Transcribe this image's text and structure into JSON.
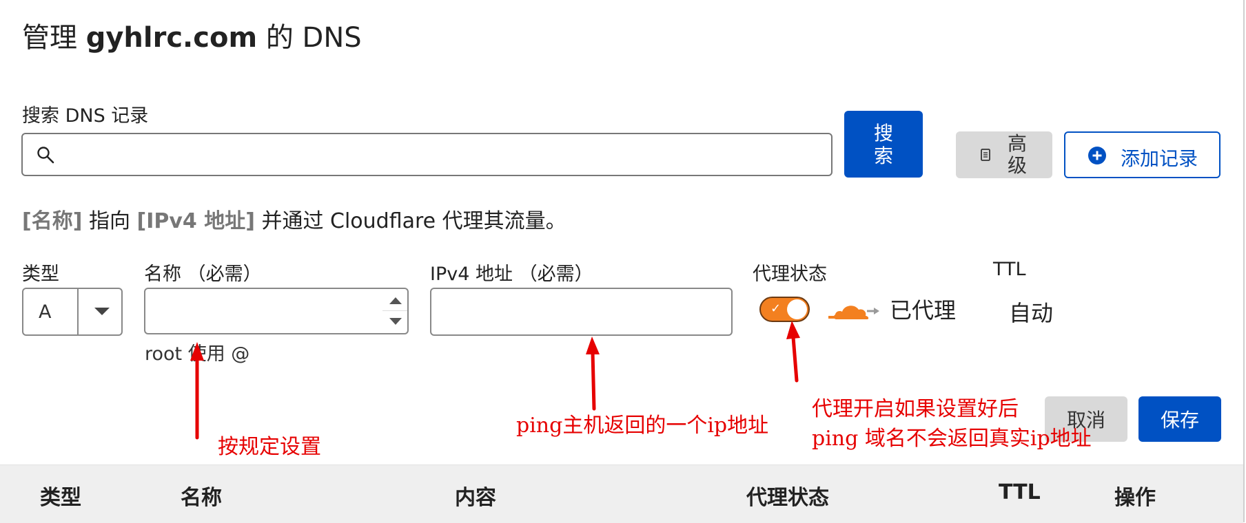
{
  "header": {
    "title_prefix": "管理 ",
    "domain": "gyhlrc.com",
    "title_suffix": " 的 DNS"
  },
  "search": {
    "label": "搜索 DNS 记录",
    "value": "",
    "button_label": "搜索",
    "icon": "search-icon"
  },
  "toolbar": {
    "advanced_label": "高级",
    "advanced_icon": "document-icon",
    "add_record_label": "添加记录",
    "add_record_icon": "plus-circle-icon"
  },
  "description": {
    "name_token": "[名称]",
    "text1": " 指向 ",
    "ipv4_token": "[IPv4 地址]",
    "text2": " 并通过 Cloudflare 代理其流量。"
  },
  "form": {
    "type_label": "类型",
    "type_value": "A",
    "name_label": "名称 （必需）",
    "name_value": "",
    "name_hint": "root 使用 @",
    "ipv4_label": "IPv4 地址 （必需）",
    "ipv4_value": "",
    "proxy_label": "代理状态",
    "proxy_on": true,
    "proxy_status_text": "已代理",
    "ttl_label": "TTL",
    "ttl_value": "自动",
    "cancel_label": "取消",
    "save_label": "保存"
  },
  "table": {
    "columns": [
      "类型",
      "名称",
      "内容",
      "代理状态",
      "TTL",
      "操作"
    ]
  },
  "annotations": {
    "name_note": "按规定设置",
    "ip_note": "ping主机返回的一个ip地址",
    "proxy_note_line1": "代理开启如果设置好后",
    "proxy_note_line2": "ping 域名不会返回真实ip地址"
  },
  "colors": {
    "primary": "#0051c3",
    "proxy_orange": "#f38020",
    "annotation_red": "#e60000"
  }
}
